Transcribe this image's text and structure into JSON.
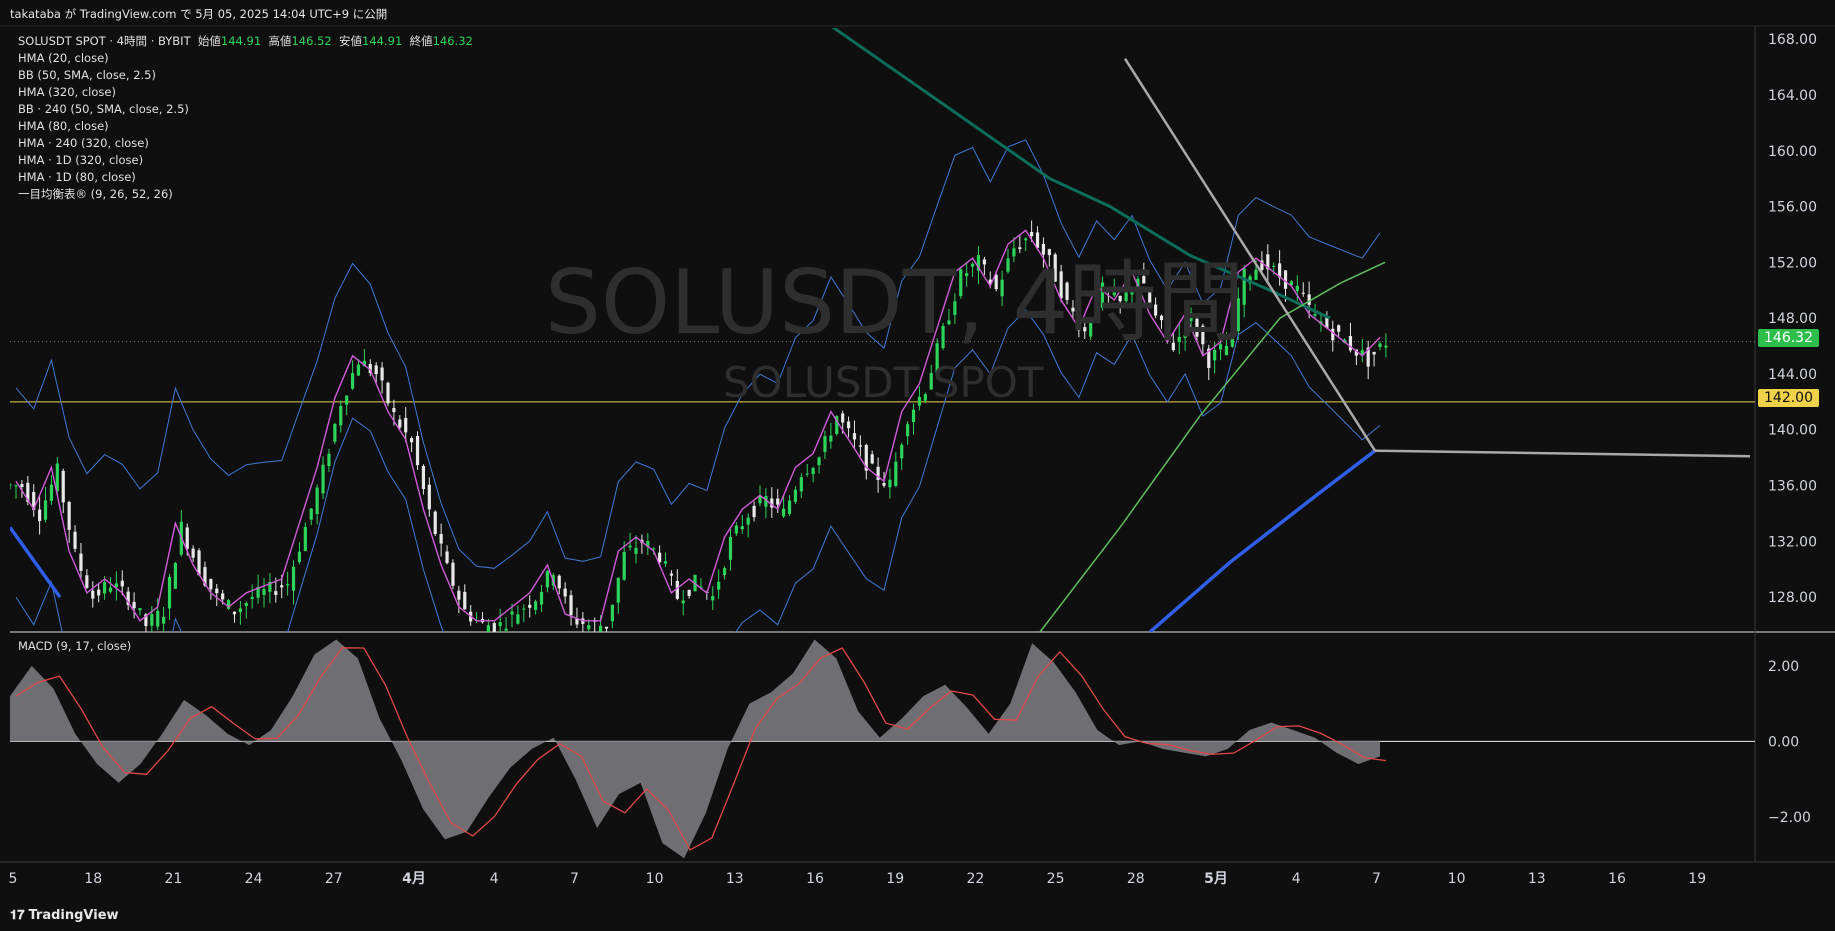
{
  "header": {
    "publish": "takataba が TradingView.com で 5月 05, 2025 14:04 UTC+9 に公開"
  },
  "legend": {
    "symbol": "SOLUSDT SPOT · 4時間 · BYBIT",
    "open_label": "始値",
    "open": "144.91",
    "high_label": "高値",
    "high": "146.52",
    "low_label": "安値",
    "low": "144.91",
    "close_label": "終値",
    "close": "146.32",
    "indicators": [
      "HMA (20, close)",
      "BB (50, SMA, close, 2.5)",
      "HMA (320, close)",
      "BB · 240 (50, SMA, close, 2.5)",
      "HMA (80, close)",
      "HMA · 240 (320, close)",
      "HMA · 1D (320, close)",
      "HMA · 1D (80, close)",
      "一目均衡表® (9, 26, 52, 26)"
    ]
  },
  "watermark": {
    "main": "SOLUSDT, 4時間",
    "sub": "SOLUSDT SPOT"
  },
  "macd": {
    "label": "MACD (9, 17, close)"
  },
  "footer": {
    "brand": "TradingView"
  },
  "price_axis": {
    "ticks": [
      "168.00",
      "164.00",
      "160.00",
      "156.00",
      "152.00",
      "148.00",
      "144.00",
      "140.00",
      "136.00",
      "132.00",
      "128.00"
    ]
  },
  "macd_axis": {
    "ticks": [
      "2.00",
      "0.00",
      "−2.00"
    ]
  },
  "time_axis": {
    "ticks": [
      "5",
      "18",
      "21",
      "24",
      "27",
      "4月",
      "4",
      "7",
      "10",
      "13",
      "16",
      "19",
      "22",
      "25",
      "28",
      "5月",
      "4",
      "7",
      "10",
      "13",
      "16",
      "19"
    ]
  },
  "badges": {
    "current_price": "146.32",
    "level": "142.00"
  },
  "colors": {
    "up": "#2dd45a",
    "down": "#e8e8e8",
    "hma_fast": "#d05bd8",
    "bb": "#3f79d6",
    "hma_blue": "#2f5ee8",
    "teal": "#0c6e5a",
    "green_line": "#5fbf5f",
    "level": "#f0d24a",
    "current": "#2dbe4b"
  },
  "chart_data": {
    "type": "candlestick",
    "title": "SOLUSDT, 4時間",
    "ylim": [
      125.5,
      168.8
    ],
    "x_labels": [
      "5",
      "18",
      "21",
      "24",
      "27",
      "4月",
      "4",
      "7",
      "10",
      "13",
      "16",
      "19",
      "22",
      "25",
      "28",
      "5月",
      "4",
      "7",
      "10",
      "13",
      "16",
      "19"
    ],
    "close_series": [
      136,
      134,
      137,
      131,
      128,
      129,
      128,
      126,
      127,
      133,
      130,
      128,
      127,
      128,
      128.5,
      129,
      133,
      137,
      142,
      145,
      144,
      141,
      139,
      134,
      130,
      127,
      126,
      126,
      127,
      128,
      130,
      126.5,
      126,
      126,
      131,
      132,
      131,
      128,
      129,
      128,
      132,
      134,
      135,
      134,
      137,
      138,
      141,
      139,
      137,
      136,
      141,
      143,
      147,
      151,
      152,
      150,
      153,
      154,
      152,
      149,
      147,
      150,
      149,
      151,
      148,
      146,
      148,
      145,
      146,
      151,
      152,
      151,
      150,
      148,
      147,
      146,
      145,
      146.32
    ],
    "levels": {
      "horizontal": 142.0,
      "last_close": 146.32
    },
    "macd": {
      "label": "MACD (9, 17, close)",
      "ylim": [
        -3.2,
        2.9
      ],
      "ticks": [
        2,
        0,
        -2
      ],
      "histogram": [
        1.2,
        2.0,
        1.4,
        0.2,
        -0.6,
        -1.1,
        -0.6,
        0.2,
        1.1,
        0.7,
        0.2,
        -0.1,
        0.3,
        1.2,
        2.3,
        2.7,
        2.2,
        0.6,
        -0.5,
        -1.8,
        -2.6,
        -2.4,
        -1.5,
        -0.7,
        -0.2,
        0.1,
        -1.0,
        -2.3,
        -1.4,
        -1.1,
        -2.7,
        -3.1,
        -1.9,
        -0.2,
        1.0,
        1.3,
        1.8,
        2.7,
        2.2,
        0.8,
        0.1,
        0.6,
        1.2,
        1.5,
        0.9,
        0.2,
        1.0,
        2.6,
        2.1,
        1.3,
        0.3,
        -0.1,
        0.0,
        -0.2,
        -0.3,
        -0.4,
        -0.2,
        0.3,
        0.5,
        0.3,
        0.1,
        -0.3,
        -0.6,
        -0.4
      ]
    }
  }
}
